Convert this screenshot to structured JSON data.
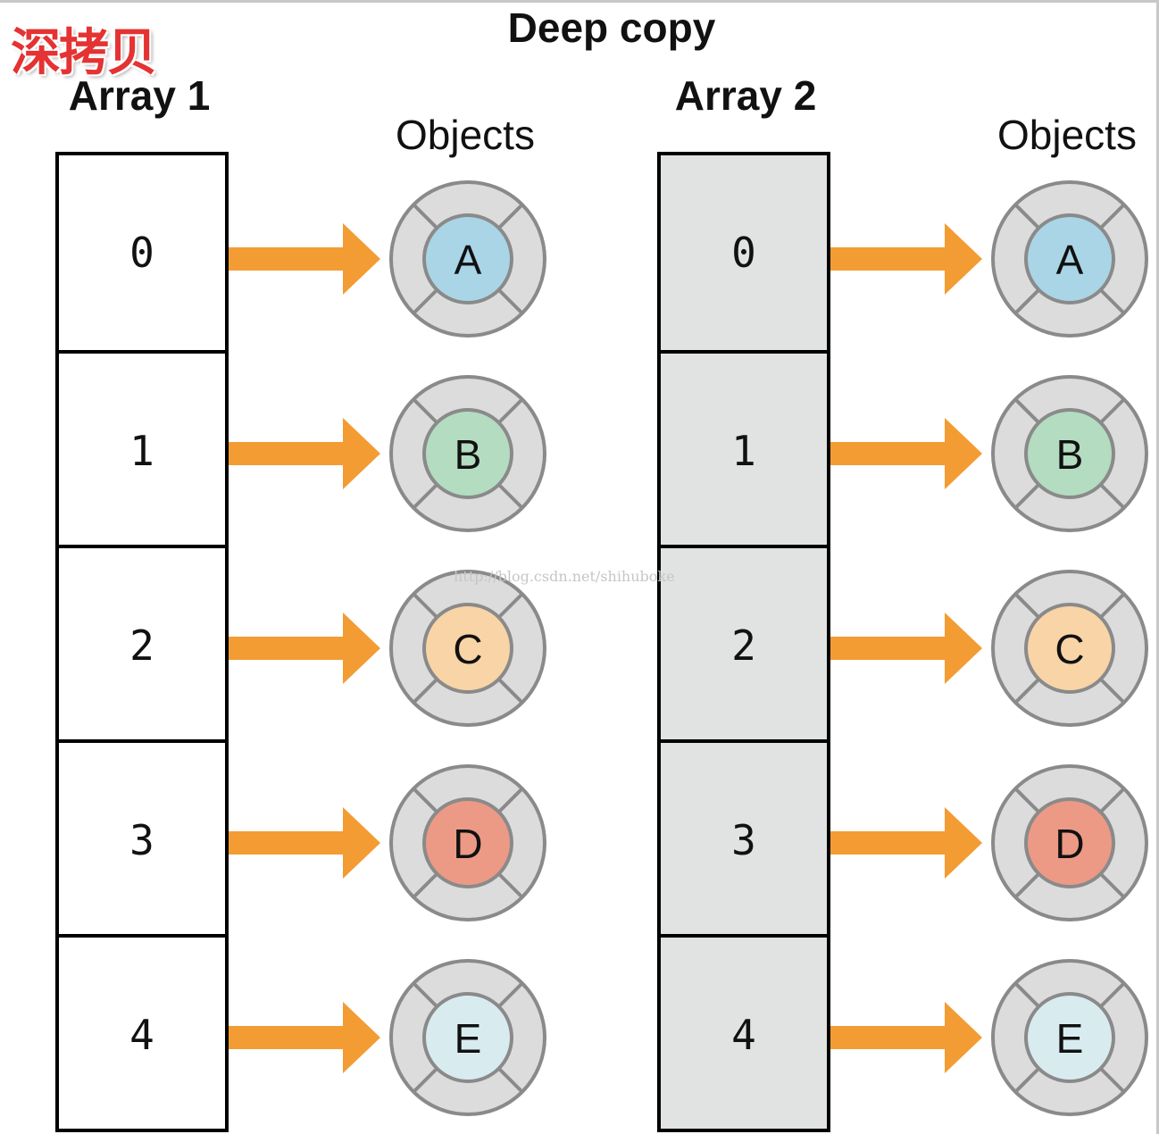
{
  "title": "Deep copy",
  "corner_mark": "深拷贝",
  "watermark": "http://blog.csdn.net/shihuboke",
  "arrays": [
    {
      "label": "Array 1",
      "objects_label": "Objects",
      "cells": [
        "0",
        "1",
        "2",
        "3",
        "4"
      ],
      "objects": [
        "A",
        "B",
        "C",
        "D",
        "E"
      ]
    },
    {
      "label": "Array 2",
      "objects_label": "Objects",
      "cells": [
        "0",
        "1",
        "2",
        "3",
        "4"
      ],
      "objects": [
        "A",
        "B",
        "C",
        "D",
        "E"
      ]
    }
  ],
  "colors": {
    "arrow": "#f39c34",
    "ring": "#dcdcdc",
    "ring_stroke": "#8a8a8a",
    "array_copy_fill": "#e1e2e2",
    "object_fills": {
      "A": "#a9d5e6",
      "B": "#b3dcc0",
      "C": "#f8d4a6",
      "D": "#ec9a85",
      "E": "#d8ecf0"
    }
  }
}
